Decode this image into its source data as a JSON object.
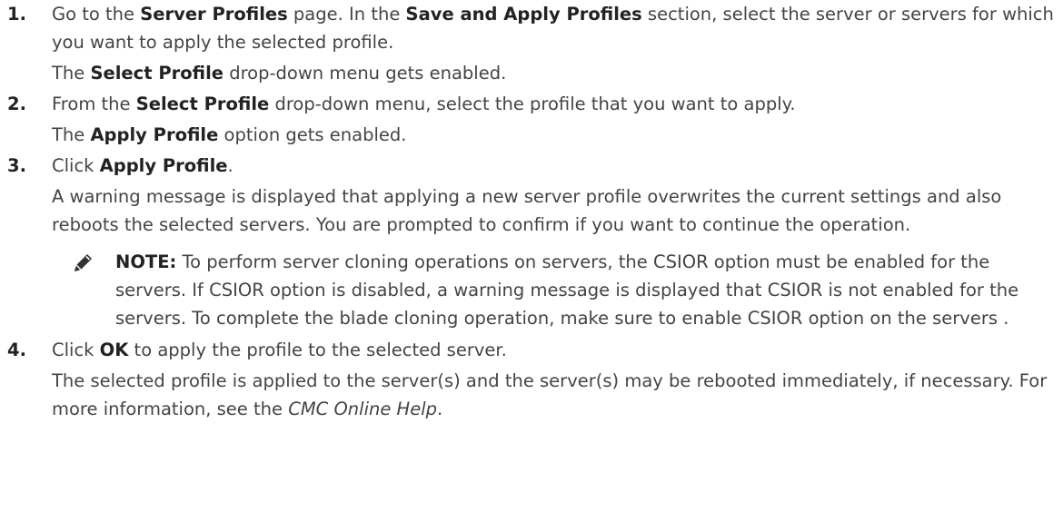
{
  "steps": [
    {
      "number": "1.",
      "text_a": "Go to the ",
      "bold_a": "Server Profiles",
      "text_b": " page. In the ",
      "bold_b": "Save and Apply Profiles",
      "text_c": " section, select the server or servers for which you want to apply the selected profile.",
      "result_pre": "The ",
      "result_bold": "Select Profile",
      "result_post": " drop-down menu gets enabled."
    },
    {
      "number": "2.",
      "text_a": "From the ",
      "bold_a": "Select Profile",
      "text_b": " drop-down menu, select the profile that you want to apply.",
      "result_pre": "The ",
      "result_bold": "Apply Profile",
      "result_post": " option gets enabled."
    },
    {
      "number": "3.",
      "text_a": "Click ",
      "bold_a": "Apply Profile",
      "text_b": ".",
      "result": "A warning message is displayed that applying a new server profile overwrites the current settings and also reboots the selected servers. You are prompted to confirm if you want to continue the operation.",
      "note": {
        "icon": "note-pencil-icon",
        "label": "NOTE:",
        "text": " To perform server cloning operations on servers, the CSIOR option must be enabled for the servers. If CSIOR option is disabled, a warning message is displayed that CSIOR is not enabled for the servers. To complete the blade cloning operation, make sure to enable CSIOR option on the servers ."
      }
    },
    {
      "number": "4.",
      "text_a": "Click ",
      "bold_a": "OK",
      "text_b": " to apply the profile to the selected server.",
      "result_pre": "The selected profile is applied to the server(s) and the server(s) may be rebooted immediately, if necessary. For more information, see the ",
      "result_italic": "CMC Online Help",
      "result_post": "."
    }
  ]
}
